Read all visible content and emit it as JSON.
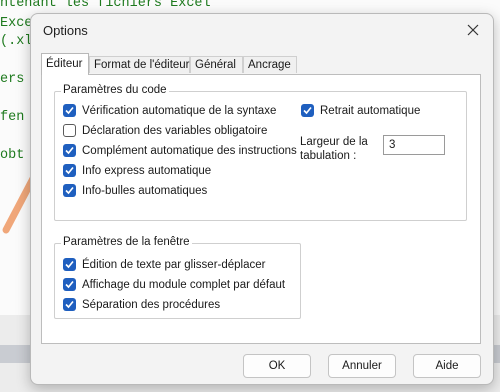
{
  "background_code": {
    "lines": [
      "ntenant les fichiers Excel",
      "Exce",
      "(.xl",
      "ers",
      "fen",
      "obt"
    ]
  },
  "dialog": {
    "title": "Options",
    "close_icon": "close-icon",
    "tabs": [
      {
        "label": "Éditeur",
        "active": true
      },
      {
        "label": "Format de l'éditeur",
        "active": false
      },
      {
        "label": "Général",
        "active": false
      },
      {
        "label": "Ancrage",
        "active": false
      }
    ],
    "code_settings": {
      "title": "Paramètres du code",
      "checkboxes": [
        {
          "label": "Vérification automatique de la syntaxe",
          "checked": true
        },
        {
          "label": "Déclaration des variables obligatoire",
          "checked": false
        },
        {
          "label": "Complément automatique des instructions",
          "checked": true
        },
        {
          "label": "Info express automatique",
          "checked": true
        },
        {
          "label": "Info-bulles automatiques",
          "checked": true
        }
      ],
      "auto_indent": {
        "label": "Retrait automatique",
        "checked": true
      },
      "tab_width": {
        "label_line1": "Largeur de la",
        "label_line2": "tabulation :",
        "value": "3"
      }
    },
    "window_settings": {
      "title": "Paramètres de la fenêtre",
      "checkboxes": [
        {
          "label": "Édition de texte par glisser-déplacer",
          "checked": true
        },
        {
          "label": "Affichage du module complet par défaut",
          "checked": true
        },
        {
          "label": "Séparation des procédures",
          "checked": true
        }
      ]
    },
    "buttons": {
      "ok": "OK",
      "cancel": "Annuler",
      "help": "Aide"
    }
  },
  "colors": {
    "checkbox_checked": "#1f5fbf",
    "code_text": "#1e7a1e",
    "arrow": "#f0a77a"
  }
}
